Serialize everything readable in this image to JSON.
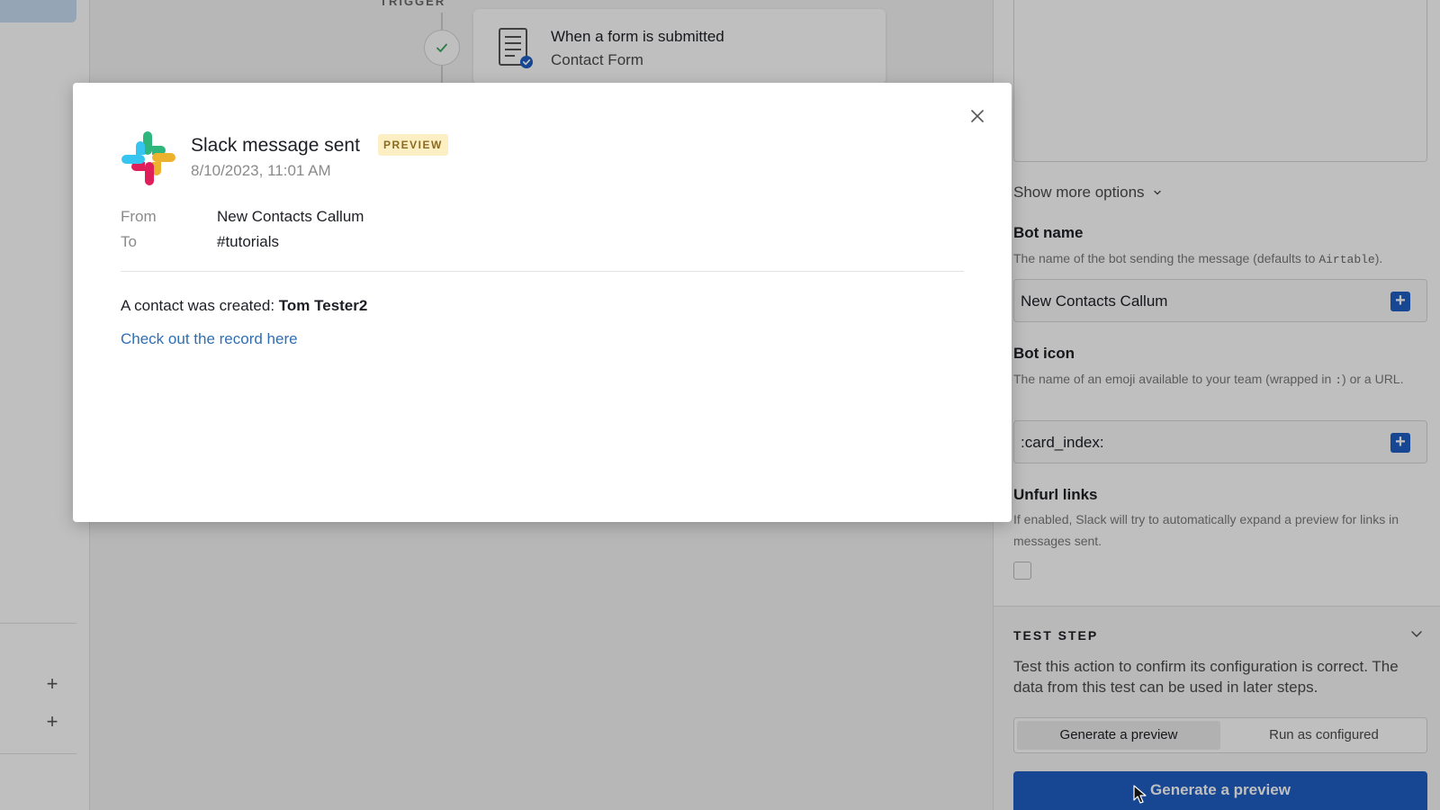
{
  "canvas": {
    "trigger_label": "TRIGGER",
    "trigger_card": {
      "title": "When a form is submitted",
      "subtitle": "Contact Form"
    }
  },
  "right_panel": {
    "show_more_options": "Show more options",
    "bot_name": {
      "label": "Bot name",
      "help_prefix": "The name of the bot sending the message (defaults to ",
      "help_code": "Airtable",
      "help_suffix": ").",
      "value": "New Contacts Callum"
    },
    "bot_icon": {
      "label": "Bot icon",
      "help_prefix": "The name of an emoji available to your team (wrapped in ",
      "help_code": ":",
      "help_suffix": ") or a URL.",
      "value": ":card_index:"
    },
    "unfurl_links": {
      "label": "Unfurl links",
      "help": "If enabled, Slack will try to automatically expand a preview for links in messages sent.",
      "checked": false
    },
    "test_step": {
      "title": "TEST STEP",
      "description": "Test this action to confirm its configuration is correct. The data from this test can be used in later steps.",
      "options": [
        "Generate a preview",
        "Run as configured"
      ],
      "selected_option": "Generate a preview",
      "primary_button": "Generate a preview"
    }
  },
  "modal": {
    "title": "Slack message sent",
    "badge": "PREVIEW",
    "timestamp": "8/10/2023, 11:01 AM",
    "from_label": "From",
    "from_value": "New Contacts Callum",
    "to_label": "To",
    "to_value": "#tutorials",
    "message_prefix": "A contact was created: ",
    "message_name": "Tom Tester2",
    "link_text": "Check out the record here"
  },
  "colors": {
    "accent": "#1f5fc4",
    "link": "#2f6fb5",
    "badge_bg": "#fdefc4",
    "slack_blue": "#36c5f0",
    "slack_green": "#2eb67d",
    "slack_red": "#e01e5a",
    "slack_yellow": "#ecb22e"
  }
}
